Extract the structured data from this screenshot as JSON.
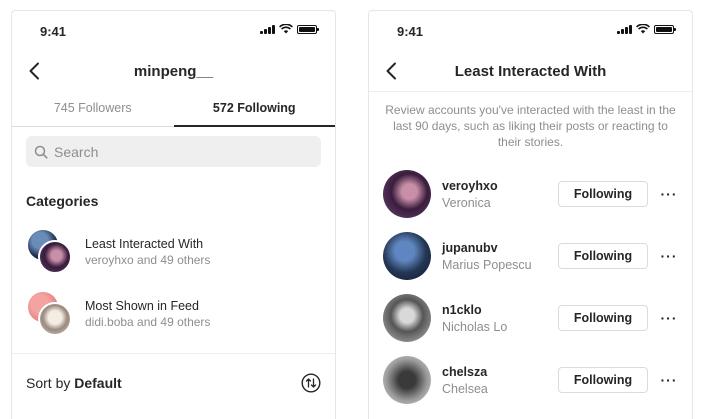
{
  "left_screen": {
    "status": {
      "time": "9:41"
    },
    "nav": {
      "title": "minpeng__",
      "back_icon": "chevron-left-icon"
    },
    "tabs": [
      {
        "label": "745 Followers",
        "active": false
      },
      {
        "label": "572 Following",
        "active": true
      }
    ],
    "search": {
      "placeholder": "Search"
    },
    "categories_title": "Categories",
    "categories": [
      {
        "name": "Least Interacted With",
        "subtitle": "veroyhxo and 49 others"
      },
      {
        "name": "Most Shown in Feed",
        "subtitle": "didi.boba and 49 others"
      }
    ],
    "sort": {
      "prefix": "Sort by ",
      "value": "Default",
      "icon": "sort-arrows-icon"
    }
  },
  "right_screen": {
    "status": {
      "time": "9:41"
    },
    "nav": {
      "title": "Least Interacted With",
      "back_icon": "chevron-left-icon"
    },
    "description": "Review accounts you've interacted with the least in the last 90 days, such as liking their posts or reacting to their stories.",
    "accounts": [
      {
        "username": "veroyhxo",
        "name": "Veronica",
        "button": "Following"
      },
      {
        "username": "jupanubv",
        "name": "Marius Popescu",
        "button": "Following"
      },
      {
        "username": "n1cklo",
        "name": "Nicholas Lo",
        "button": "Following"
      },
      {
        "username": "chelsza",
        "name": "Chelsea",
        "button": "Following"
      }
    ]
  },
  "colors": {
    "text": "#262626",
    "secondary": "#8e8e8e",
    "border": "#dbdbdb",
    "search_bg": "#efefef"
  }
}
